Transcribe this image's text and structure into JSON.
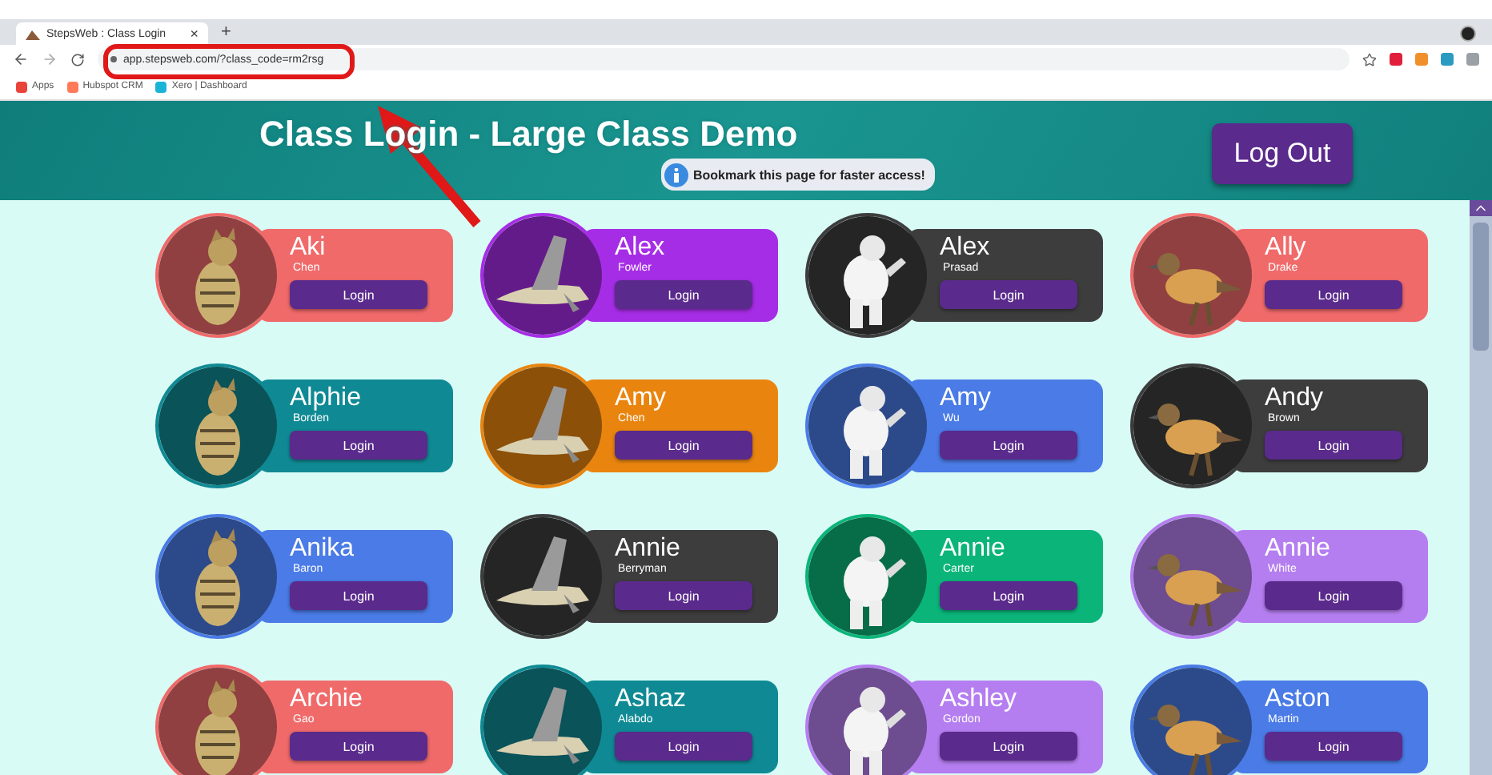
{
  "browser": {
    "tab_title": "StepsWeb : Class Login",
    "tab_close": "×",
    "new_tab": "+",
    "url": "app.stepsweb.com/?class_code=rm2rsg",
    "bookmarks": [
      {
        "label": "Apps",
        "kind": "apps"
      },
      {
        "label": "Hubspot CRM",
        "kind": "hubspot"
      },
      {
        "label": "Xero | Dashboard",
        "kind": "xero"
      }
    ]
  },
  "header": {
    "title": "Class Login - Large Class Demo",
    "notice": "Bookmark this page for faster access!",
    "logout": "Log Out"
  },
  "students": [
    {
      "first": "Aki",
      "last": "Chen",
      "color": "#f06a6a",
      "button": "Login"
    },
    {
      "first": "Alex",
      "last": "Fowler",
      "color": "#a62de6",
      "button": "Login"
    },
    {
      "first": "Alex",
      "last": "Prasad",
      "color": "#3d3d3d",
      "button": "Login"
    },
    {
      "first": "Ally",
      "last": "Drake",
      "color": "#f06a6a",
      "button": "Login"
    },
    {
      "first": "Alphie",
      "last": "Borden",
      "color": "#0f8a94",
      "button": "Login"
    },
    {
      "first": "Amy",
      "last": "Chen",
      "color": "#e9850f",
      "button": "Login"
    },
    {
      "first": "Amy",
      "last": "Wu",
      "color": "#4a7be6",
      "button": "Login"
    },
    {
      "first": "Andy",
      "last": "Brown",
      "color": "#3d3d3d",
      "button": "Login"
    },
    {
      "first": "Anika",
      "last": "Baron",
      "color": "#4a7be6",
      "button": "Login"
    },
    {
      "first": "Annie",
      "last": "Berryman",
      "color": "#3d3d3d",
      "button": "Login"
    },
    {
      "first": "Annie",
      "last": "Carter",
      "color": "#0bb57a",
      "button": "Login"
    },
    {
      "first": "Annie",
      "last": "White",
      "color": "#b57ef0",
      "button": "Login"
    },
    {
      "first": "Archie",
      "last": "Gao",
      "color": "#f06a6a",
      "button": "Login"
    },
    {
      "first": "Ashaz",
      "last": "Alabdo",
      "color": "#0f8a94",
      "button": "Login"
    },
    {
      "first": "Ashley",
      "last": "Gordon",
      "color": "#b57ef0",
      "button": "Login"
    },
    {
      "first": "Aston",
      "last": "Martin",
      "color": "#4a7be6",
      "button": "Login"
    }
  ]
}
